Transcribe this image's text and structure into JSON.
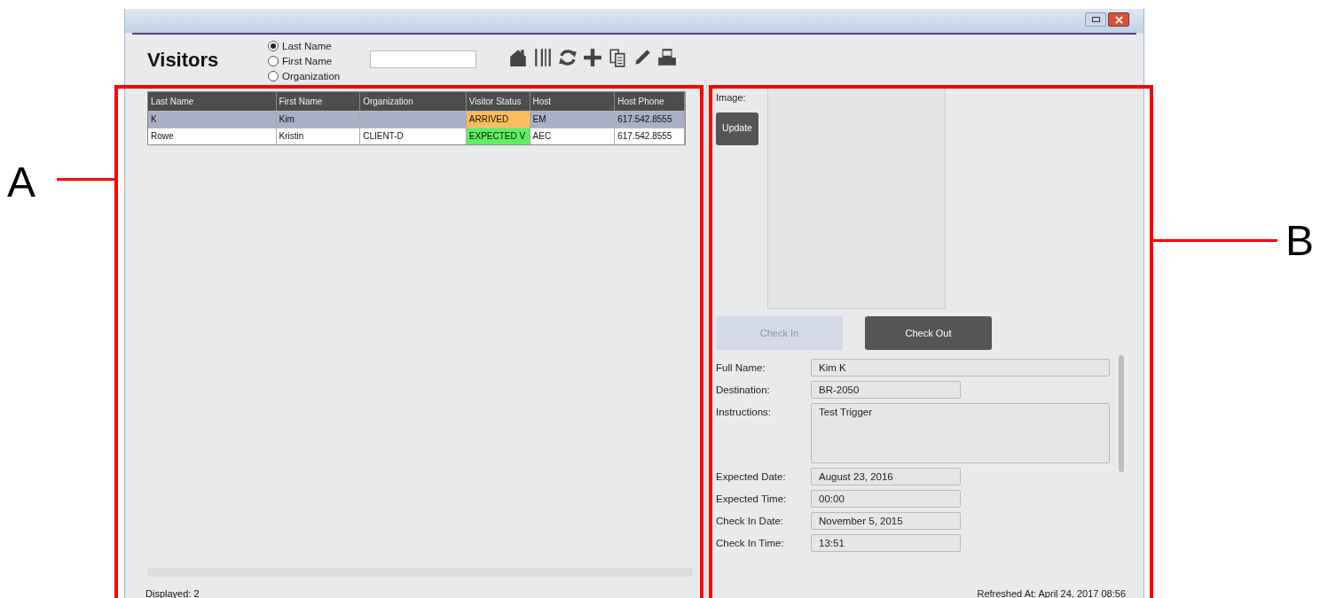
{
  "header": {
    "title": "Visitors",
    "search_by": [
      {
        "label": "Last Name",
        "selected": true
      },
      {
        "label": "First Name",
        "selected": false
      },
      {
        "label": "Organization",
        "selected": false
      }
    ]
  },
  "table": {
    "columns": [
      "Last Name",
      "First Name",
      "Organization",
      "Visitor Status",
      "Host",
      "Host Phone"
    ],
    "rows": [
      {
        "selected": true,
        "color": "#fcbc5c",
        "cells": [
          "K",
          "Kim",
          "",
          "ARRIVED",
          "EM",
          "617.542.8555"
        ]
      },
      {
        "selected": false,
        "color": "#5ef05e",
        "cells": [
          "Rowe",
          "Kristin",
          "CLIENT-D",
          "EXPECTED V",
          "AEC",
          "617.542.8555"
        ]
      }
    ]
  },
  "details": {
    "image_label": "Image:",
    "update_button": "Update",
    "buttons": [
      {
        "label": "Check In",
        "disabled": true
      },
      {
        "label": "Check Out",
        "disabled": false
      }
    ],
    "fields": [
      {
        "label": "Full Name:",
        "value": "Kim K",
        "kind": "wide"
      },
      {
        "label": "Destination:",
        "value": "BR-2050",
        "kind": "short"
      },
      {
        "label": "Instructions:",
        "value": "Test Trigger",
        "kind": "multiline"
      },
      {
        "label": "Expected Date:",
        "value": "August 23, 2016",
        "kind": "short"
      },
      {
        "label": "Expected Time:",
        "value": "00:00",
        "kind": "short"
      },
      {
        "label": "Check In Date:",
        "value": "November 5, 2015",
        "kind": "short"
      },
      {
        "label": "Check In Time:",
        "value": "13:51",
        "kind": "short"
      }
    ]
  },
  "footer": {
    "displayed": "Displayed: 2",
    "refreshed": "Refreshed At: April 24, 2017 08:56"
  },
  "annotations": [
    {
      "label": "A"
    },
    {
      "label": "B"
    }
  ]
}
